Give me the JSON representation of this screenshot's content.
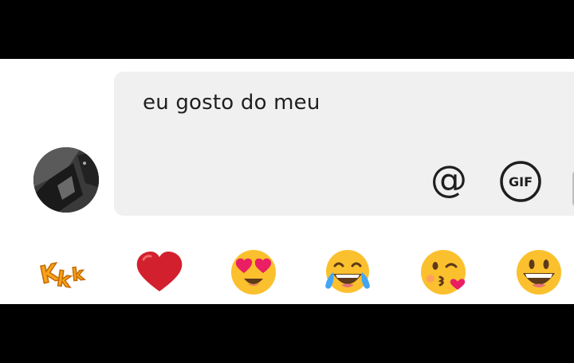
{
  "composer": {
    "text": "eu gosto do meu",
    "mention_symbol": "@",
    "gif_label": "GIF"
  },
  "avatar": {
    "icon": "user-avatar-photo"
  },
  "reactions": [
    {
      "icon": "kkk-sticker",
      "text": "Kkk"
    },
    {
      "icon": "red-heart"
    },
    {
      "icon": "heart-eyes-face"
    },
    {
      "icon": "tears-of-joy-face"
    },
    {
      "icon": "kissing-heart-face"
    },
    {
      "icon": "grinning-face"
    }
  ],
  "colors": {
    "composer_bg": "#f0f0f0",
    "panel_bg": "#ffffff",
    "heart_red": "#d3202e",
    "emoji_yellow": "#fbc02d",
    "text": "#1f1f1f"
  }
}
